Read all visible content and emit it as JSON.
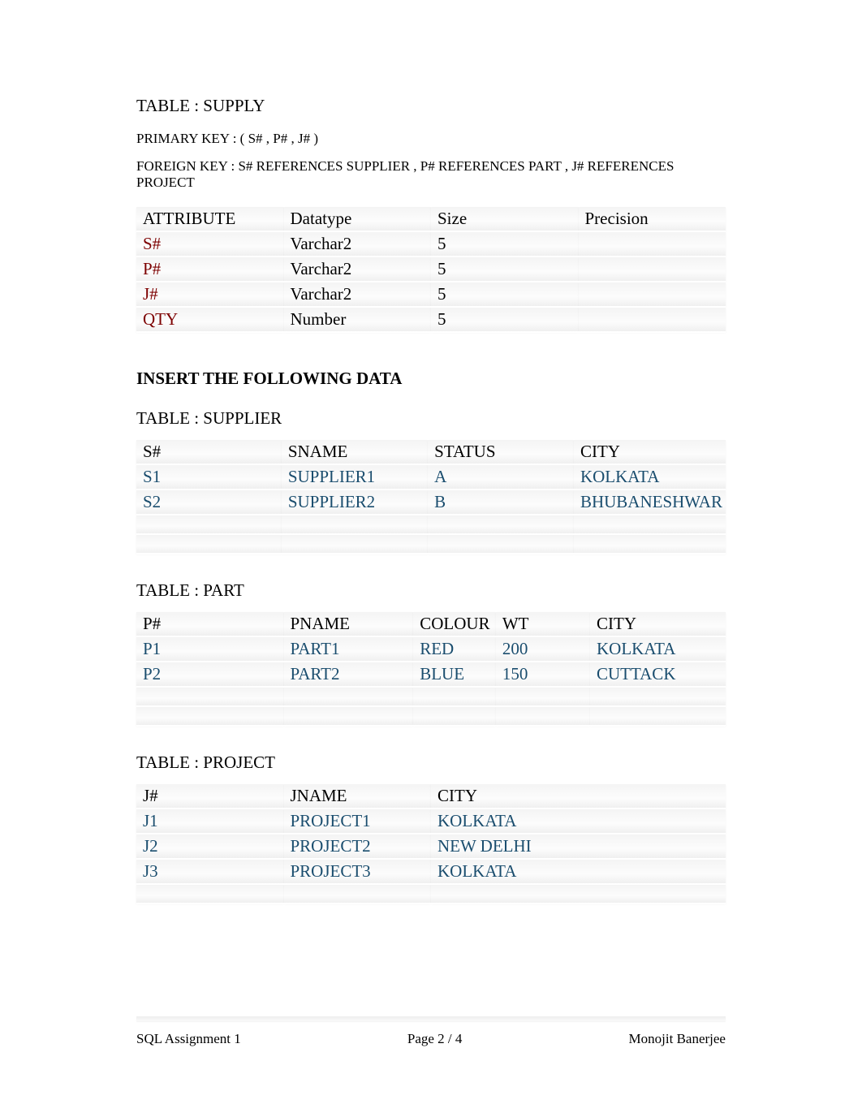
{
  "supply_section": {
    "title": "TABLE : SUPPLY",
    "primary_key": "PRIMARY KEY : ( S# , P# , J# )",
    "foreign_key": "FOREIGN KEY : S# REFERENCES SUPPLIER , P# REFERENCES PART , J# REFERENCES PROJECT",
    "headers": [
      "ATTRIBUTE",
      "Datatype",
      "Size",
      "Precision"
    ],
    "rows": [
      [
        "S#",
        "Varchar2",
        "5",
        ""
      ],
      [
        "P#",
        "Varchar2",
        "5",
        ""
      ],
      [
        "J#",
        "Varchar2",
        "5",
        ""
      ],
      [
        "QTY",
        "Number",
        "5",
        ""
      ]
    ]
  },
  "insert_heading": "INSERT THE FOLLOWING DATA",
  "supplier_section": {
    "title": "TABLE : SUPPLIER",
    "headers": [
      "S#",
      "SNAME",
      "STATUS",
      "CITY"
    ],
    "rows": [
      [
        "S1",
        "SUPPLIER1",
        "A",
        "KOLKATA"
      ],
      [
        "S2",
        "SUPPLIER2",
        "B",
        "BHUBANESHWAR"
      ]
    ],
    "empty_rows": 2
  },
  "part_section": {
    "title": "TABLE : PART",
    "headers": [
      "P#",
      "PNAME",
      "COLOUR",
      "WT",
      "CITY"
    ],
    "rows": [
      [
        "P1",
        "PART1",
        "RED",
        "200",
        "KOLKATA"
      ],
      [
        "P2",
        "PART2",
        "BLUE",
        "150",
        "CUTTACK"
      ]
    ],
    "empty_rows": 2
  },
  "project_section": {
    "title": "TABLE : PROJECT",
    "headers": [
      "J#",
      "JNAME",
      "CITY"
    ],
    "rows": [
      [
        "J1",
        "PROJECT1",
        "KOLKATA"
      ],
      [
        "J2",
        "PROJECT2",
        "NEW DELHI"
      ],
      [
        "J3",
        "PROJECT3",
        "KOLKATA"
      ]
    ],
    "empty_rows": 1
  },
  "footer": {
    "left": "SQL Assignment 1",
    "center": "Page 2 / 4",
    "right": "Monojit Banerjee"
  }
}
